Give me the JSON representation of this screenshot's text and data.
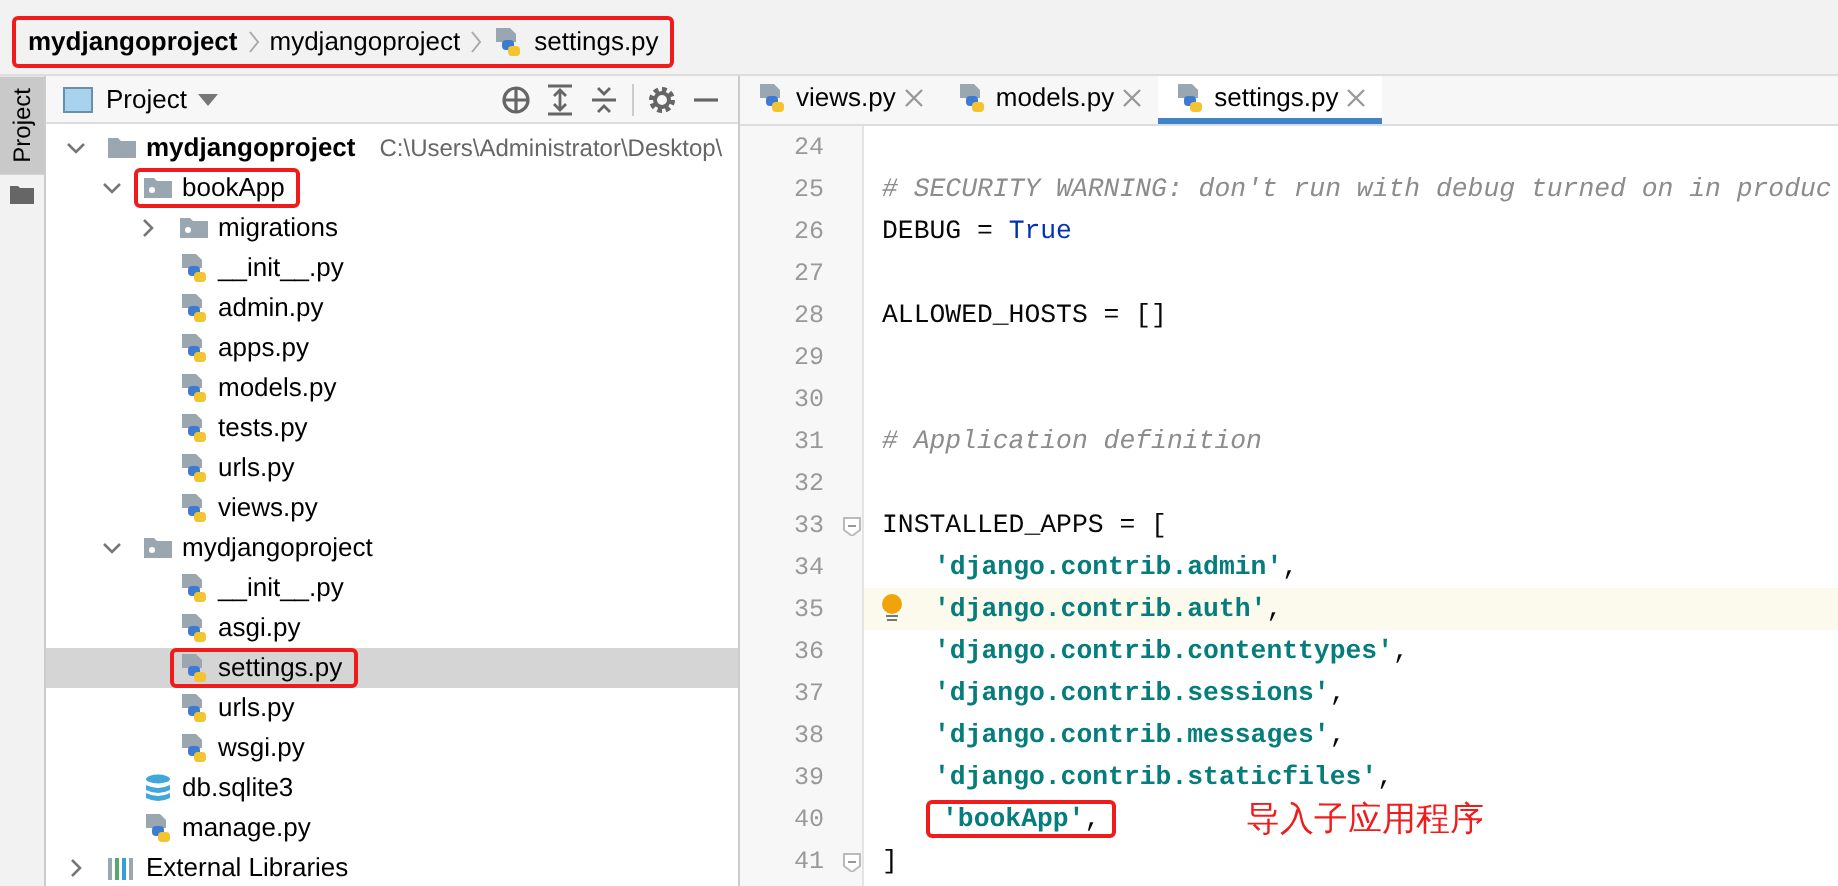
{
  "breadcrumb": {
    "annotated": true,
    "items": [
      {
        "label": "mydjangoproject",
        "kind": "project"
      },
      {
        "label": "mydjangoproject",
        "kind": "folder"
      },
      {
        "label": "settings.py",
        "kind": "python"
      }
    ]
  },
  "side_tab": {
    "label": "Project"
  },
  "project_panel": {
    "title": "Project",
    "tree": [
      {
        "label": "mydjangoproject",
        "path": "C:\\Users\\Administrator\\Desktop\\",
        "kind": "root",
        "expanded": true,
        "selected": false,
        "annotated": false,
        "children": [
          {
            "label": "bookApp",
            "kind": "package",
            "expanded": true,
            "selected": false,
            "annotated": true,
            "children": [
              {
                "label": "migrations",
                "kind": "package",
                "expanded": false,
                "selected": false,
                "annotated": false
              },
              {
                "label": "__init__.py",
                "kind": "python",
                "selected": false,
                "annotated": false
              },
              {
                "label": "admin.py",
                "kind": "python",
                "selected": false,
                "annotated": false
              },
              {
                "label": "apps.py",
                "kind": "python",
                "selected": false,
                "annotated": false
              },
              {
                "label": "models.py",
                "kind": "python",
                "selected": false,
                "annotated": false
              },
              {
                "label": "tests.py",
                "kind": "python",
                "selected": false,
                "annotated": false
              },
              {
                "label": "urls.py",
                "kind": "python",
                "selected": false,
                "annotated": false
              },
              {
                "label": "views.py",
                "kind": "python",
                "selected": false,
                "annotated": false
              }
            ]
          },
          {
            "label": "mydjangoproject",
            "kind": "package",
            "expanded": true,
            "selected": false,
            "annotated": false,
            "children": [
              {
                "label": "__init__.py",
                "kind": "python",
                "selected": false,
                "annotated": false
              },
              {
                "label": "asgi.py",
                "kind": "python",
                "selected": false,
                "annotated": false
              },
              {
                "label": "settings.py",
                "kind": "python",
                "selected": true,
                "annotated": true
              },
              {
                "label": "urls.py",
                "kind": "python",
                "selected": false,
                "annotated": false
              },
              {
                "label": "wsgi.py",
                "kind": "python",
                "selected": false,
                "annotated": false
              }
            ]
          },
          {
            "label": "db.sqlite3",
            "kind": "database",
            "selected": false,
            "annotated": false
          },
          {
            "label": "manage.py",
            "kind": "python",
            "selected": false,
            "annotated": false
          }
        ]
      },
      {
        "label": "External Libraries",
        "kind": "library",
        "expanded": false,
        "selected": false,
        "annotated": false
      }
    ]
  },
  "editor": {
    "tabs": [
      {
        "label": "views.py",
        "selected": false
      },
      {
        "label": "models.py",
        "selected": false
      },
      {
        "label": "settings.py",
        "selected": true
      }
    ],
    "lines": [
      {
        "number": "24"
      },
      {
        "number": "25",
        "tokens": [
          {
            "kind": "comment",
            "text": "# SECURITY WARNING: don't run with debug turned on in produc"
          }
        ]
      },
      {
        "number": "26",
        "tokens": [
          {
            "kind": "plain",
            "text": "DEBUG = "
          },
          {
            "kind": "keyword",
            "text": "True"
          }
        ]
      },
      {
        "number": "27"
      },
      {
        "number": "28",
        "tokens": [
          {
            "kind": "plain",
            "text": "ALLOWED_HOSTS = []"
          }
        ]
      },
      {
        "number": "29"
      },
      {
        "number": "30"
      },
      {
        "number": "31",
        "tokens": [
          {
            "kind": "comment",
            "text": "# Application definition"
          }
        ]
      },
      {
        "number": "32"
      },
      {
        "number": "33",
        "fold": true,
        "tokens": [
          {
            "kind": "plain",
            "text": "INSTALLED_APPS = ["
          }
        ]
      },
      {
        "number": "34",
        "indented": true,
        "tokens": [
          {
            "kind": "string",
            "text": "'django.contrib.admin'"
          },
          {
            "kind": "plain",
            "text": ","
          }
        ]
      },
      {
        "number": "35",
        "indented": true,
        "current": true,
        "tokens": [
          {
            "kind": "string",
            "text": "'django.contrib.auth'"
          },
          {
            "kind": "plain",
            "text": ","
          }
        ]
      },
      {
        "number": "36",
        "indented": true,
        "tokens": [
          {
            "kind": "string",
            "text": "'django.contrib.contenttypes'"
          },
          {
            "kind": "plain",
            "text": ","
          }
        ]
      },
      {
        "number": "37",
        "indented": true,
        "tokens": [
          {
            "kind": "string",
            "text": "'django.contrib.sessions'"
          },
          {
            "kind": "plain",
            "text": ","
          }
        ]
      },
      {
        "number": "38",
        "indented": true,
        "tokens": [
          {
            "kind": "string",
            "text": "'django.contrib.messages'"
          },
          {
            "kind": "plain",
            "text": ","
          }
        ]
      },
      {
        "number": "39",
        "indented": true,
        "tokens": [
          {
            "kind": "string",
            "text": "'django.contrib.staticfiles'"
          },
          {
            "kind": "plain",
            "text": ","
          }
        ]
      },
      {
        "number": "40",
        "indented": true,
        "annotated": true,
        "tokens": [
          {
            "kind": "string",
            "text": "'bookApp'"
          },
          {
            "kind": "plain",
            "text": ","
          }
        ]
      },
      {
        "number": "41",
        "fold": true,
        "tokens": [
          {
            "kind": "plain",
            "text": "]"
          }
        ]
      }
    ],
    "annotation": "导入子应用程序"
  }
}
